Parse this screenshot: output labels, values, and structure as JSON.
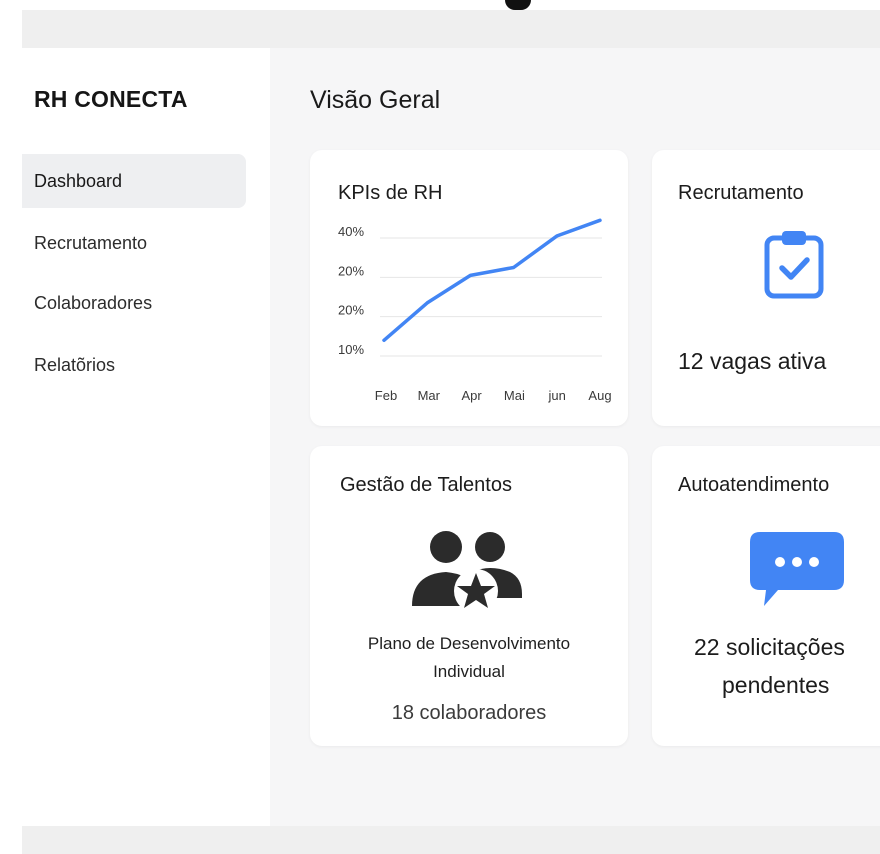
{
  "app": {
    "brand": "RH CONECTA"
  },
  "sidebar": {
    "items": [
      {
        "label": "Dashboard",
        "active": true
      },
      {
        "label": "Recrutamento",
        "active": false
      },
      {
        "label": "Colaboradores",
        "active": false
      },
      {
        "label": "Relatõrios",
        "active": false
      }
    ]
  },
  "main": {
    "title": "Visão Geral",
    "kpi_card": {
      "title": "KPIs de RH"
    },
    "recruitment_card": {
      "title": "Recrutamento",
      "icon": "clipboard-check-icon",
      "value": "12 vagas ativa"
    },
    "talent_card": {
      "title": "Gestão de Talentos",
      "icon": "team-star-icon",
      "plan_line1": "Plano de Desenvolvimento",
      "plan_line2": "Individual",
      "count": "18 colaboradores"
    },
    "selfservice_card": {
      "title": "Autoatendimento",
      "icon": "chat-bubble-icon",
      "line1": "22 solicitações",
      "line2": "pendentes"
    }
  },
  "colors": {
    "accent": "#4285f4",
    "dark_icon": "#2b2b2b",
    "card_bg": "#ffffff",
    "app_bg": "#f6f6f7"
  },
  "chart_data": {
    "type": "line",
    "title": "KPIs de RH",
    "categories": [
      "Feb",
      "Mar",
      "Apr",
      "Mai",
      "jun",
      "Aug"
    ],
    "y_tick_labels": [
      "40%",
      "20%",
      "20%",
      "10%"
    ],
    "values": [
      0.4,
      1.35,
      2.05,
      2.25,
      3.05,
      3.45
    ],
    "ylim": [
      0,
      3
    ],
    "grid": true,
    "series_color": "#4285f4"
  }
}
